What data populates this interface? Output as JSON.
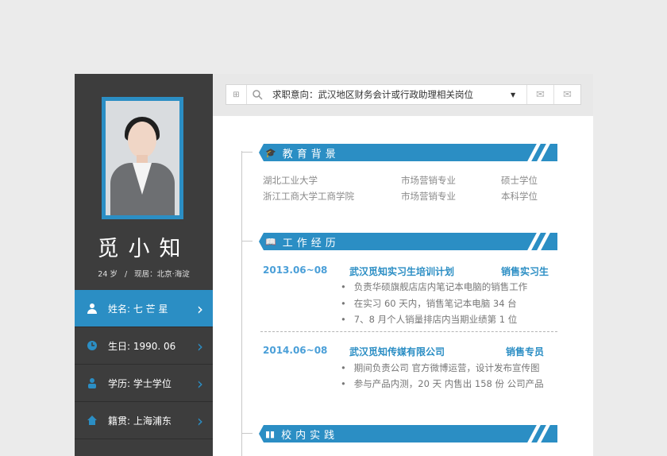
{
  "profile": {
    "name": "觅小知",
    "age": "24 岁",
    "separator": "/",
    "location": "现居：北京·海淀"
  },
  "info_items": [
    {
      "label": "姓名: 七 芒 星",
      "icon": "user-icon"
    },
    {
      "label": "生日: 1990. 06",
      "icon": "clock-icon"
    },
    {
      "label": "学历: 学士学位",
      "icon": "graduate-icon"
    },
    {
      "label": "籍贯: 上海浦东",
      "icon": "home-icon"
    }
  ],
  "search": {
    "text": "求职意向：武汉地区财务会计或行政助理相关岗位"
  },
  "education": {
    "title": "教育背景",
    "rows": [
      {
        "school": "湖北工业大学",
        "major": "市场营销专业",
        "degree": "硕士学位"
      },
      {
        "school": "浙江工商大学工商学院",
        "major": "市场营销专业",
        "degree": "本科学位"
      }
    ]
  },
  "work": {
    "title": "工作经历",
    "jobs": [
      {
        "date": "2013.06~08",
        "company": "武汉觅知实习生培训计划",
        "role": "销售实习生",
        "bullets": [
          "负责华硕旗舰店店内笔记本电脑的销售工作",
          "在实习 60 天内，销售笔记本电脑 34 台",
          "7、8 月个人销量排店内当期业绩第 1 位"
        ]
      },
      {
        "date": "2014.06~08",
        "company": "武汉觅知传媒有限公司",
        "role": "销售专员",
        "bullets": [
          "期间负责公司  官方微博运营，设计发布宣传图",
          "参与产品内测，20 天  内售出  158 份  公司产品"
        ]
      }
    ]
  },
  "practice": {
    "title": "校内实践"
  },
  "colors": {
    "accent": "#2b8ec4",
    "sidebar": "#3d3d3d"
  }
}
